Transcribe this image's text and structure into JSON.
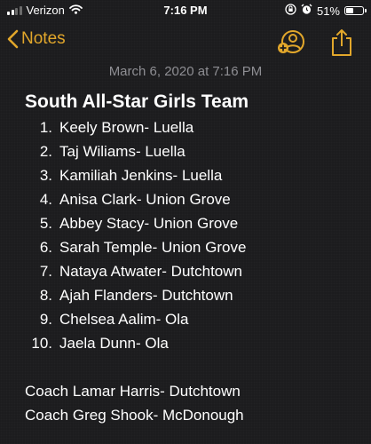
{
  "status_bar": {
    "carrier": "Verizon",
    "time": "7:16 PM",
    "battery": "51%",
    "battery_level": 0.51,
    "icons": [
      "signal-icon",
      "wifi-icon",
      "orientation-lock-icon",
      "alarm-icon",
      "battery-icon"
    ]
  },
  "nav": {
    "back_label": "Notes",
    "accent_color": "#e2a72b",
    "icons": [
      "chevron-left-icon",
      "add-people-icon",
      "share-icon"
    ]
  },
  "note": {
    "date": "March 6, 2020 at 7:16 PM",
    "title": "South All-Star Girls Team",
    "players": [
      {
        "num": "1.",
        "text": "Keely Brown- Luella"
      },
      {
        "num": "2.",
        "text": "Taj Wiliams- Luella"
      },
      {
        "num": "3.",
        "text": "Kamiliah Jenkins- Luella"
      },
      {
        "num": "4.",
        "text": "Anisa Clark- Union Grove"
      },
      {
        "num": "5.",
        "text": "Abbey Stacy- Union Grove"
      },
      {
        "num": "6.",
        "text": "Sarah Temple- Union Grove"
      },
      {
        "num": "7.",
        "text": "Nataya Atwater- Dutchtown"
      },
      {
        "num": "8.",
        "text": "Ajah Flanders- Dutchtown"
      },
      {
        "num": "9.",
        "text": "Chelsea Aalim- Ola"
      },
      {
        "num": "10.",
        "text": "Jaela Dunn- Ola"
      }
    ],
    "coaches": [
      "Coach Lamar Harris- Dutchtown",
      "Coach Greg Shook- McDonough"
    ]
  },
  "colors": {
    "background": "#1c1c1e",
    "text": "#ffffff",
    "date_text": "#8e8e93",
    "accent": "#e2a72b"
  }
}
